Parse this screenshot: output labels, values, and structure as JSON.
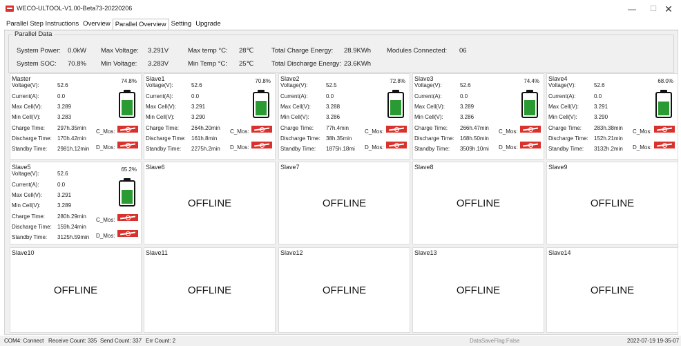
{
  "window": {
    "title": "WECO-ULTOOL-V1.00-Beta73-20220206",
    "minimize": "—",
    "maximize": "☐",
    "close": "✕"
  },
  "tabs": [
    "Parallel Step Instructions",
    "Overview",
    "Parallel Overview",
    "Setting",
    "Upgrade"
  ],
  "active_tab": "Parallel Overview",
  "parallel_data": {
    "title": "Parallel Data",
    "system_power_label": "System Power:",
    "system_power": "0.0kW",
    "max_voltage_label": "Max Voltage:",
    "max_voltage": "3.291V",
    "max_temp_label": "Max temp °C:",
    "max_temp": "28℃",
    "total_charge_label": "Total Charge Energy:",
    "total_charge": "28.9KWh",
    "modules_label": "Modules Connected:",
    "modules": "06",
    "system_soc_label": "System SOC:",
    "system_soc": "70.8%",
    "min_voltage_label": "Min Voltage:",
    "min_voltage": "3.283V",
    "min_temp_label": "Min Temp °C:",
    "min_temp": "25℃",
    "total_discharge_label": "Total Discharge Energy:",
    "total_discharge": "23.6KWh"
  },
  "labels": {
    "voltage": "Voltage(V):",
    "current": "Current(A):",
    "max_cell": "Max Cell(V):",
    "min_cell": "Min Cell(V):",
    "charge_time": "Charge Time:",
    "discharge_time": "Discharge Time:",
    "standby_time": "Standby Time:",
    "c_mos": "C_Mos:",
    "d_mos": "D_Mos:",
    "offline": "OFFLINE"
  },
  "modules": [
    {
      "name": "Master",
      "online": true,
      "voltage": "52.6",
      "current": "0.0",
      "max_cell": "3.289",
      "min_cell": "3.283",
      "charge_time": "297h.35min",
      "discharge_time": "170h.42min",
      "standby_time": "2981h.12min",
      "soc_label": "74.8%",
      "soc": 0.748
    },
    {
      "name": "Slave1",
      "online": true,
      "voltage": "52.6",
      "current": "0.0",
      "max_cell": "3.291",
      "min_cell": "3.290",
      "charge_time": "264h.20min",
      "discharge_time": "161h.8min",
      "standby_time": "2275h.2min",
      "soc_label": "70.8%",
      "soc": 0.708
    },
    {
      "name": "Slave2",
      "online": true,
      "voltage": "52.5",
      "current": "0.0",
      "max_cell": "3.288",
      "min_cell": "3.286",
      "charge_time": "77h.4min",
      "discharge_time": "38h.35min",
      "standby_time": "1875h.18mi",
      "soc_label": "72.8%",
      "soc": 0.728
    },
    {
      "name": "Slave3",
      "online": true,
      "voltage": "52.6",
      "current": "0.0",
      "max_cell": "3.289",
      "min_cell": "3.286",
      "charge_time": "266h.47min",
      "discharge_time": "168h.50min",
      "standby_time": "3509h.10mi",
      "soc_label": "74.4%",
      "soc": 0.744
    },
    {
      "name": "Slave4",
      "online": true,
      "voltage": "52.6",
      "current": "0.0",
      "max_cell": "3.291",
      "min_cell": "3.290",
      "charge_time": "283h.38min",
      "discharge_time": "152h.21min",
      "standby_time": "3132h.2min",
      "soc_label": "68.0%",
      "soc": 0.68
    },
    {
      "name": "Slave5",
      "online": true,
      "voltage": "52.6",
      "current": "0.0",
      "max_cell": "3.291",
      "min_cell": "3.289",
      "charge_time": "280h.29min",
      "discharge_time": "159h.24min",
      "standby_time": "3125h.59min",
      "soc_label": "65.2%",
      "soc": 0.652
    },
    {
      "name": "Slave6",
      "online": false
    },
    {
      "name": "Slave7",
      "online": false
    },
    {
      "name": "Slave8",
      "online": false
    },
    {
      "name": "Slave9",
      "online": false
    },
    {
      "name": "Slave10",
      "online": false
    },
    {
      "name": "Slave11",
      "online": false
    },
    {
      "name": "Slave12",
      "online": false
    },
    {
      "name": "Slave13",
      "online": false
    },
    {
      "name": "Slave14",
      "online": false
    }
  ],
  "status_bar": {
    "port": "COM4: Connect",
    "receive": "Receive Count: 335",
    "send": "Send Count: 337",
    "err": "Err Count: 2",
    "flag": "DataSaveFlag:False",
    "datetime": "2022-07-19 19-35-07"
  },
  "colors": {
    "battery_fill": "#2a9a32",
    "mos_switch": "#d9312b",
    "panel_bg": "#f0f0f0"
  },
  "icons": {
    "app": "weco-logo-icon",
    "mos": "mos-switch-icon",
    "battery": "battery-icon"
  }
}
